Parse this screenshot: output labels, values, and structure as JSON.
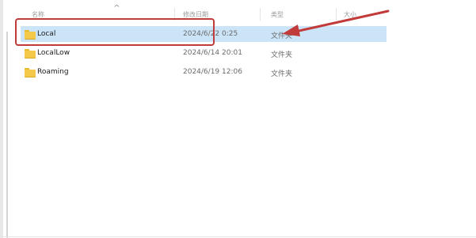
{
  "columns": {
    "name": "名称",
    "date": "修改日期",
    "type": "类型",
    "size": "大小"
  },
  "files": [
    {
      "name": "Local",
      "date": "2024/6/22 0:25",
      "type": "文件夹",
      "selected": true
    },
    {
      "name": "LocalLow",
      "date": "2024/6/14 20:01",
      "type": "文件夹",
      "selected": false
    },
    {
      "name": "Roaming",
      "date": "2024/6/19 12:06",
      "type": "文件夹",
      "selected": false
    }
  ],
  "icons": {
    "folder": "folder-icon",
    "sort": "sort-ascending-icon"
  },
  "colors": {
    "selection": "#cce4f7",
    "annotation": "#c23b3b",
    "folder": "#f4c94a"
  }
}
